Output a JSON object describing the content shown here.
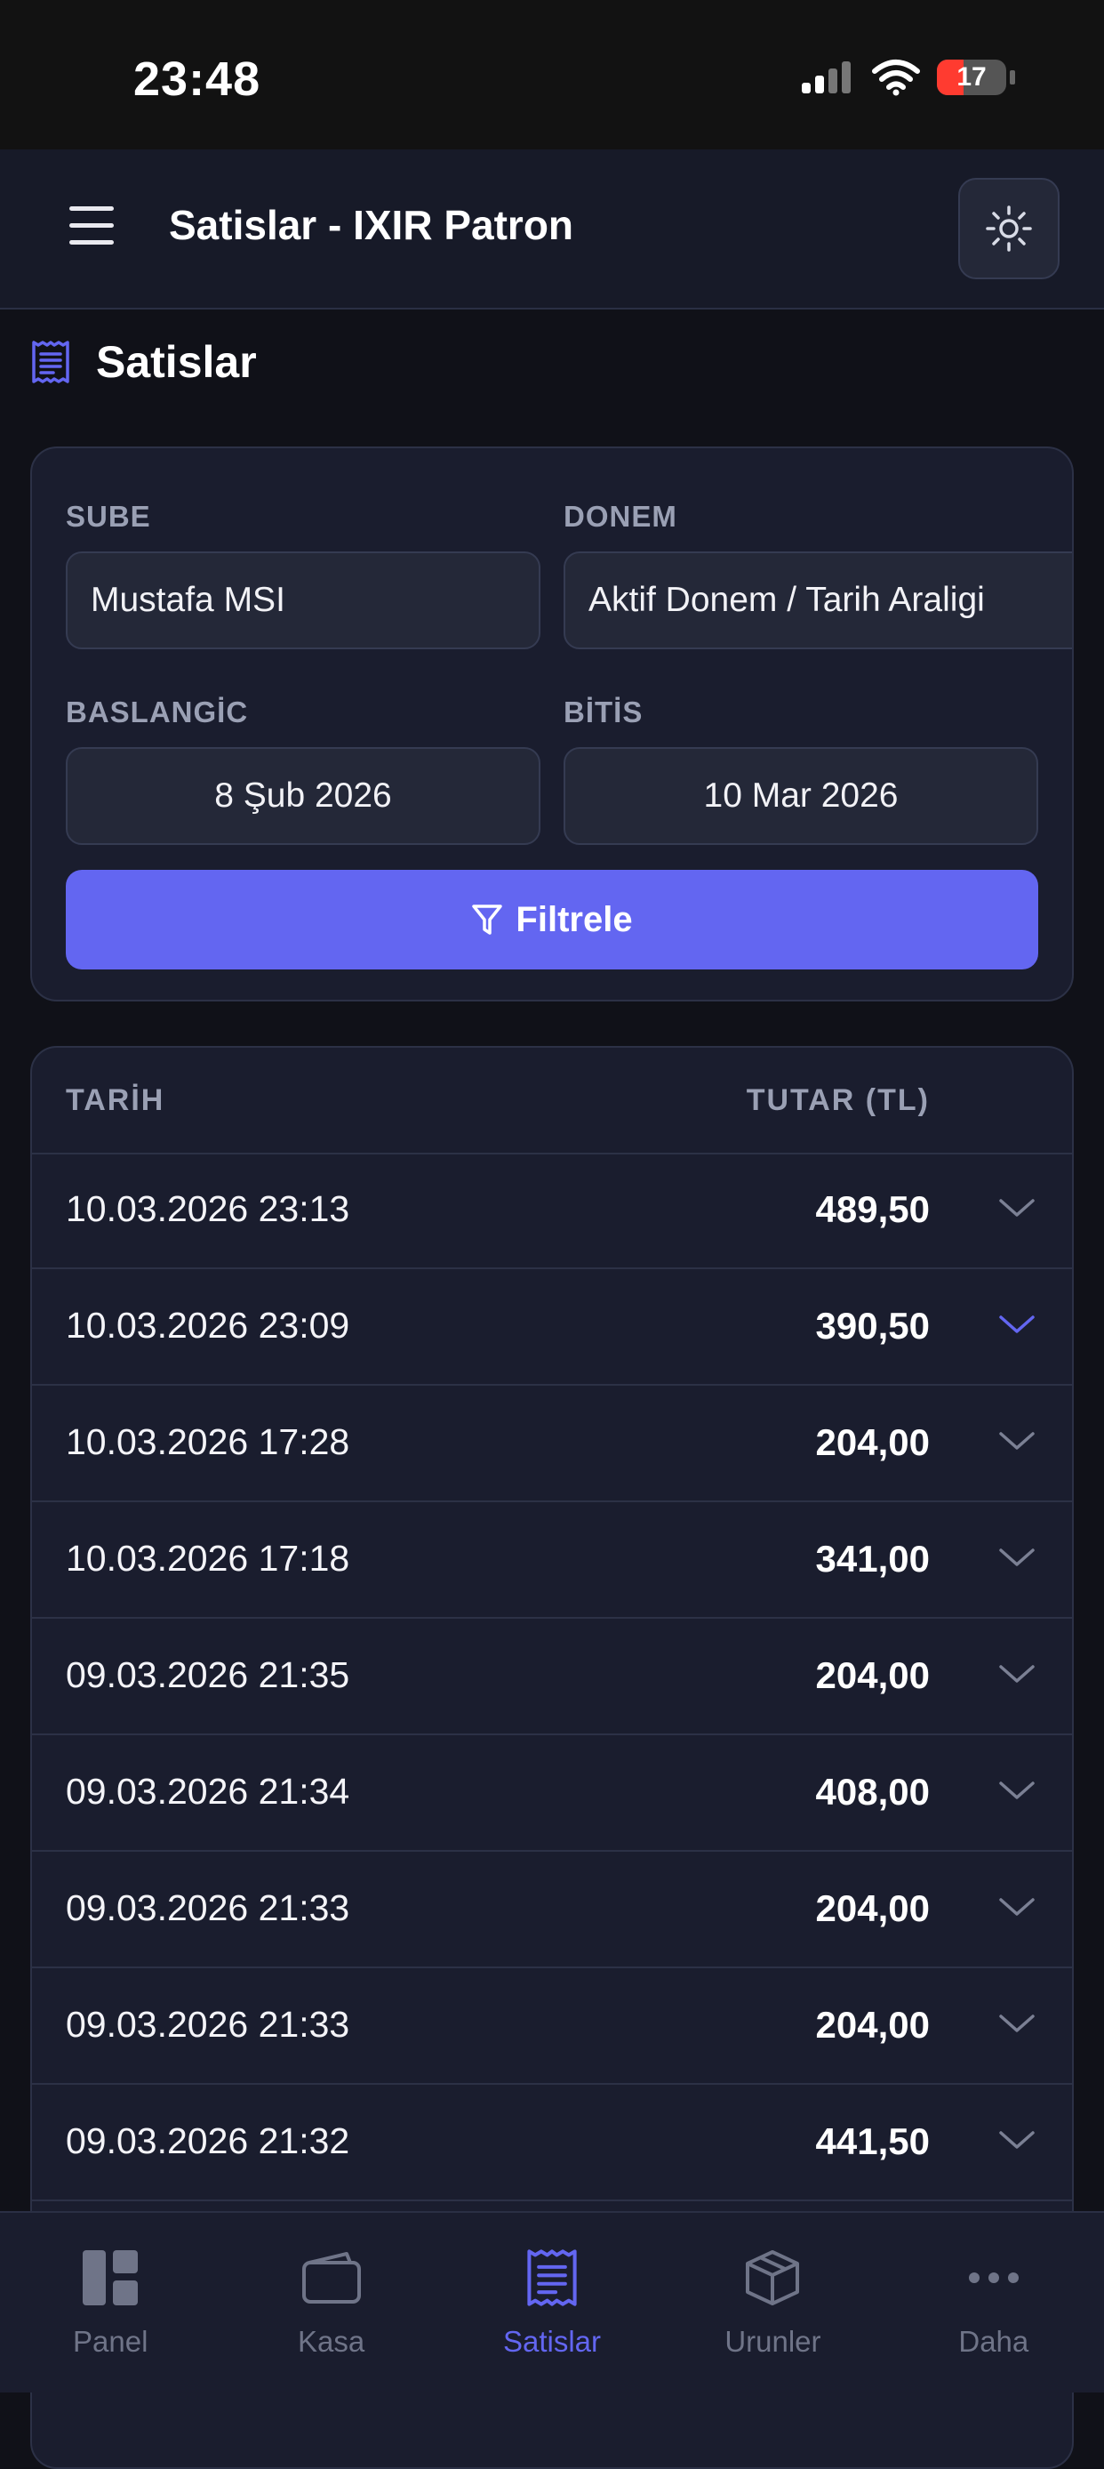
{
  "status_bar": {
    "time": "23:48",
    "battery": "17",
    "battery_level": 0.17
  },
  "header": {
    "title": "Satislar - IXIR Patron",
    "menu_icon": "hamburger-icon",
    "theme_icon": "sun-icon"
  },
  "page": {
    "title": "Satislar",
    "icon": "receipt-icon"
  },
  "filters": {
    "sube_label": "SUBE",
    "sube_value": "Mustafa MSI",
    "donem_label": "DONEM",
    "donem_value": "Aktif Donem / Tarih Araligi",
    "baslangic_label": "BASLANGİC",
    "baslangic_value": "8 Şub 2026",
    "bitis_label": "BİTİS",
    "bitis_value": "10 Mar 2026",
    "filter_button": "Filtrele"
  },
  "table": {
    "col_date": "TARİH",
    "col_amount": "TUTAR (TL)",
    "rows": [
      {
        "date": "10.03.2026 23:13",
        "amount": "489,50",
        "highlight": false
      },
      {
        "date": "10.03.2026 23:09",
        "amount": "390,50",
        "highlight": true
      },
      {
        "date": "10.03.2026 17:28",
        "amount": "204,00",
        "highlight": false
      },
      {
        "date": "10.03.2026 17:18",
        "amount": "341,00",
        "highlight": false
      },
      {
        "date": "09.03.2026 21:35",
        "amount": "204,00",
        "highlight": false
      },
      {
        "date": "09.03.2026 21:34",
        "amount": "408,00",
        "highlight": false
      },
      {
        "date": "09.03.2026 21:33",
        "amount": "204,00",
        "highlight": false
      },
      {
        "date": "09.03.2026 21:33",
        "amount": "204,00",
        "highlight": false
      },
      {
        "date": "09.03.2026 21:32",
        "amount": "441,50",
        "highlight": false
      }
    ]
  },
  "nav": {
    "active": "Satislar",
    "accent": "#6366f1",
    "items": [
      {
        "label": "Panel",
        "icon": "dashboard-icon"
      },
      {
        "label": "Kasa",
        "icon": "wallet-icon"
      },
      {
        "label": "Satislar",
        "icon": "receipt-icon"
      },
      {
        "label": "Urunler",
        "icon": "box-icon"
      },
      {
        "label": "Daha",
        "icon": "more-icon"
      }
    ]
  }
}
